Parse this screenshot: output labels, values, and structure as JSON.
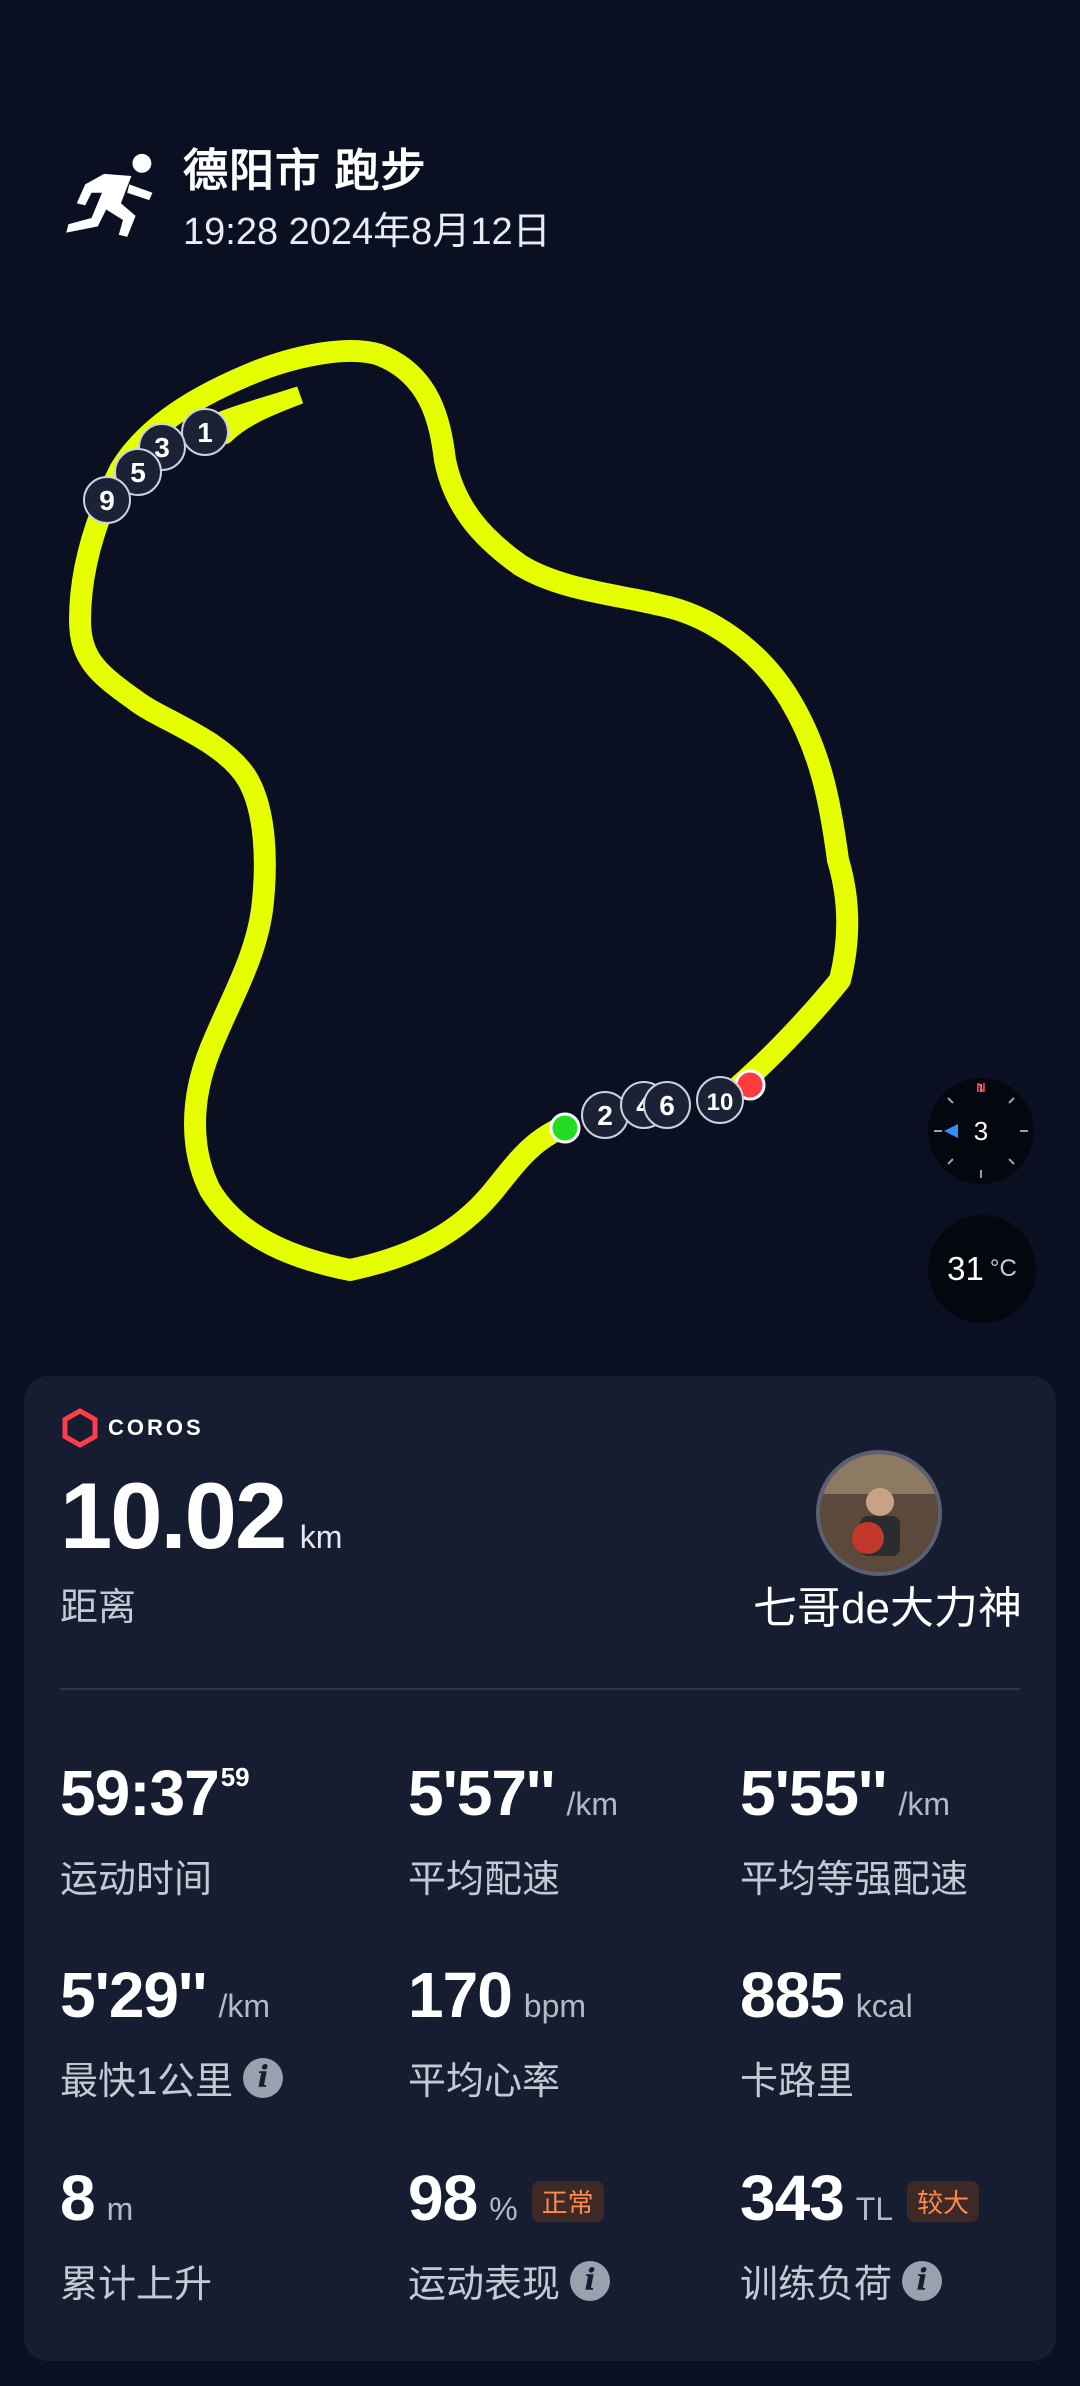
{
  "header": {
    "title": "德阳市 跑步",
    "subtitle": "19:28 2024年8月12日"
  },
  "map": {
    "route_color": "#e6ff00",
    "start_color": "#22dd22",
    "end_color": "#ff3b3b",
    "km_markers": [
      "1",
      "3",
      "5",
      "9",
      "2",
      "4",
      "6",
      "10"
    ]
  },
  "compass": {
    "north_label": "N",
    "value": "3"
  },
  "weather": {
    "temperature": "31",
    "unit": "°C"
  },
  "card": {
    "brand": "COROS",
    "distance": {
      "value": "10.02",
      "unit": "km",
      "label": "距离"
    },
    "user": {
      "name": "七哥de大力神"
    },
    "metrics": [
      {
        "value": "59:37",
        "sup": "59",
        "unit": "",
        "label": "运动时间"
      },
      {
        "value": "5'57''",
        "unit": "/km",
        "label": "平均配速"
      },
      {
        "value": "5'55''",
        "unit": "/km",
        "label": "平均等强配速"
      },
      {
        "value": "5'29''",
        "unit": "/km",
        "label": "最快1公里"
      },
      {
        "value": "170",
        "unit": "bpm",
        "label": "平均心率"
      },
      {
        "value": "885",
        "unit": "kcal",
        "label": "卡路里"
      },
      {
        "value": "8",
        "unit": "m",
        "label": "累计上升"
      },
      {
        "value": "98",
        "unit": "%",
        "badge": "正常",
        "label": "运动表现"
      },
      {
        "value": "343",
        "unit": "TL",
        "badge": "较大",
        "label": "训练负荷"
      }
    ],
    "info_symbol": "i"
  }
}
